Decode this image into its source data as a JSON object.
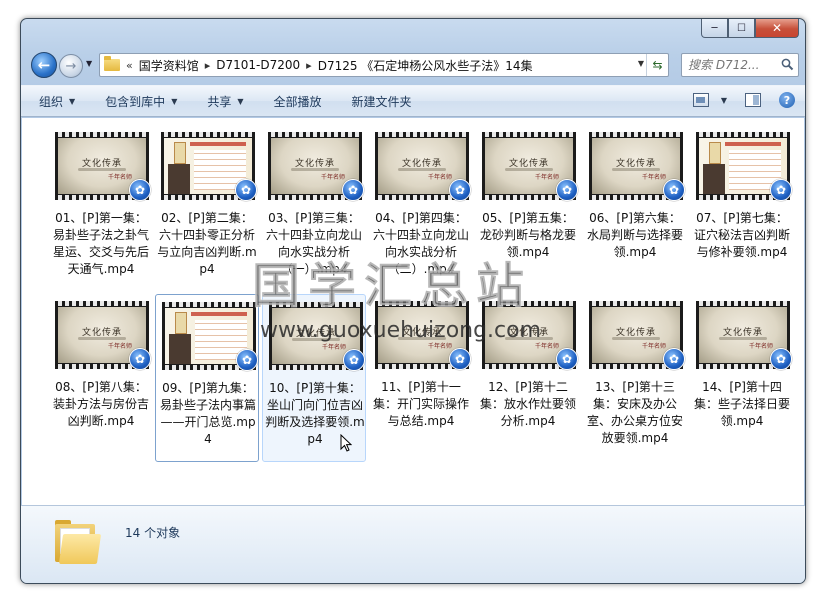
{
  "window": {
    "caption_buttons": {
      "minimize": "─",
      "maximize": "☐",
      "close": "✕"
    }
  },
  "nav": {
    "back_glyph": "←",
    "forward_glyph": "→",
    "breadcrumb_prefix": "«",
    "breadcrumbs": [
      "国学资料馆",
      "D7101-D7200",
      "D7125 《石定坤杨公风水些子法》14集"
    ],
    "search_placeholder": "搜索 D712..."
  },
  "toolbar": {
    "organize": "组织",
    "include_library": "包含到库中",
    "share": "共享",
    "play_all": "全部播放",
    "new_folder": "新建文件夹",
    "help": "?"
  },
  "thumb_caption": {
    "brush_line": "文化传承",
    "brush_sub": "千年名师"
  },
  "files": [
    {
      "name": "01、[P]第一集：易卦些子法之卦气星运、交爻与先后天通气.mp4",
      "thumb": "title"
    },
    {
      "name": "02、[P]第二集：六十四卦零正分析与立向吉凶判断.mp4",
      "thumb": "doc"
    },
    {
      "name": "03、[P]第三集：六十四卦立向龙山向水实战分析（一）.mp4",
      "thumb": "title"
    },
    {
      "name": "04、[P]第四集：六十四卦立向龙山向水实战分析（二）.mp4",
      "thumb": "title"
    },
    {
      "name": "05、[P]第五集：龙砂判断与格龙要领.mp4",
      "thumb": "title"
    },
    {
      "name": "06、[P]第六集：水局判断与选择要领.mp4",
      "thumb": "title"
    },
    {
      "name": "07、[P]第七集：证穴秘法吉凶判断与修补要领.mp4",
      "thumb": "doc"
    },
    {
      "name": "08、[P]第八集：装卦方法与房份吉凶判断.mp4",
      "thumb": "title"
    },
    {
      "name": "09、[P]第九集：易卦些子法内事篇——开门总览.mp4",
      "thumb": "doc"
    },
    {
      "name": "10、[P]第十集：坐山门向门位吉凶判断及选择要领.mp4",
      "thumb": "title"
    },
    {
      "name": "11、[P]第十一集：开门实际操作与总结.mp4",
      "thumb": "title"
    },
    {
      "name": "12、[P]第十二集：放水作灶要领分析.mp4",
      "thumb": "title"
    },
    {
      "name": "13、[P]第十三集：安床及办公室、办公桌方位安放要领.mp4",
      "thumb": "title"
    },
    {
      "name": "14、[P]第十四集：些子法择日要领.mp4",
      "thumb": "title"
    }
  ],
  "details": {
    "count_text": "14 个对象"
  },
  "watermark": {
    "title": "国学汇总站",
    "url": "www.guoxuehuizong.com"
  },
  "colors": {
    "frame_border": "#3c4b5a",
    "toolbar_text": "#1e395b",
    "media_badge": "#1d5fc2"
  }
}
